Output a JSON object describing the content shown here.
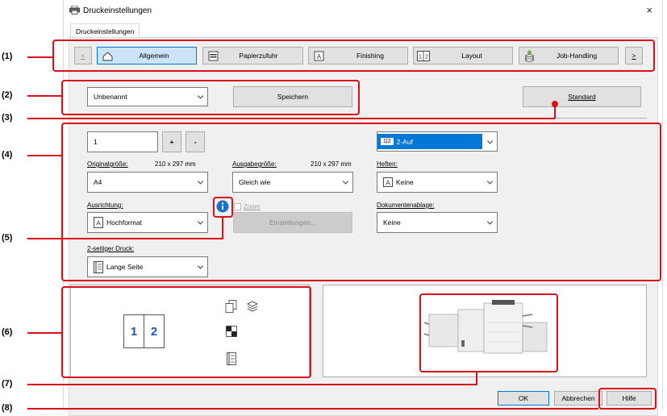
{
  "window": {
    "title": "Druckeinstellungen",
    "close": "×"
  },
  "tab": "Druckeinstellungen",
  "tabs": {
    "prev": "<",
    "next": ">",
    "items": [
      {
        "label": "Allgemein",
        "icon": "home-icon"
      },
      {
        "label": "Papierzufuhr",
        "icon": "paper-tray-icon"
      },
      {
        "label": "Finishing",
        "icon": "finishing-icon"
      },
      {
        "label": "Layout",
        "icon": "layout-icon"
      },
      {
        "label": "Job-Handling",
        "icon": "job-handling-icon"
      }
    ]
  },
  "favorites": {
    "value": "Unbenannt",
    "save": "Speichern",
    "standard": "Standard"
  },
  "copies": {
    "value": "1",
    "plus": "+",
    "minus": "-"
  },
  "nup": {
    "value": "2-Auf",
    "icon_text": "1|2"
  },
  "original_size": {
    "label": "Originalgröße:",
    "dims": "210 x 297 mm",
    "value": "A4"
  },
  "output_size": {
    "label": "Ausgabegröße:",
    "dims": "210 x 297 mm",
    "value": "Gleich wie"
  },
  "staple": {
    "label": "Heften:",
    "value": "Keine"
  },
  "orientation": {
    "label": "Ausrichtung:",
    "value": "Hochformat"
  },
  "zoom": {
    "label": "Zoom",
    "settings": "Einstellungen..."
  },
  "output_tray": {
    "label": "Dokumentenablage:",
    "value": "Keine"
  },
  "duplex": {
    "label": "2-seitiger Druck:",
    "value": "Lange Seite"
  },
  "preview": {
    "page1": "1",
    "page2": "2"
  },
  "footer": {
    "ok": "OK",
    "cancel": "Abbrechen",
    "help": "Hilfe"
  },
  "callouts": [
    "(1)",
    "(2)",
    "(3)",
    "(4)",
    "(5)",
    "(6)",
    "(7)",
    "(8)"
  ],
  "colors": {
    "callout": "#d90f19",
    "select": "#0078d7"
  }
}
